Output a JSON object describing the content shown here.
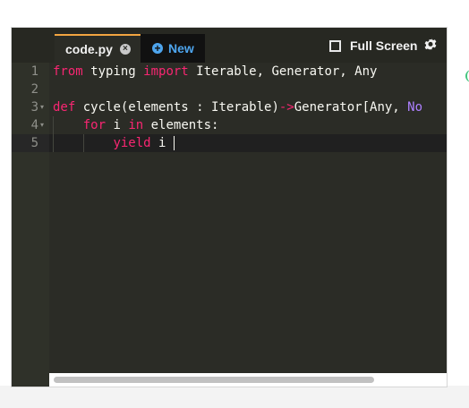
{
  "tabs": {
    "active": {
      "label": "code.py",
      "close_icon": "close-icon"
    },
    "new": {
      "label": "New",
      "icon": "plus-circle-icon"
    }
  },
  "toolbar": {
    "fullscreen_label": "Full Screen",
    "fullscreen_icon": "fullscreen-icon",
    "settings_icon": "gear-icon"
  },
  "editor": {
    "theme_colors": {
      "background": "#2b2c26",
      "keyword": "#f92672",
      "text": "#f8f8f2",
      "constant": "#ae81ff",
      "tab_accent": "#f2a541",
      "link_blue": "#4ea5ee"
    },
    "line_numbers": [
      "1",
      "2",
      "3",
      "4",
      "5"
    ],
    "fold_marker": "▾",
    "lines": [
      {
        "kw1": "from",
        "t1": " typing ",
        "kw2": "import",
        "t2": " Iterable, Generator, Any"
      },
      {},
      {
        "kw1": "def",
        "t1": " cycle(elements : Iterable)",
        "kw2": "->",
        "t2": "Generator[Any, ",
        "const": "No"
      },
      {
        "indent": "    ",
        "kw1": "for",
        "t1": " i ",
        "kw2": "in",
        "t2": " elements:"
      },
      {
        "indent": "        ",
        "kw1": "yield",
        "t1": " i"
      }
    ]
  }
}
